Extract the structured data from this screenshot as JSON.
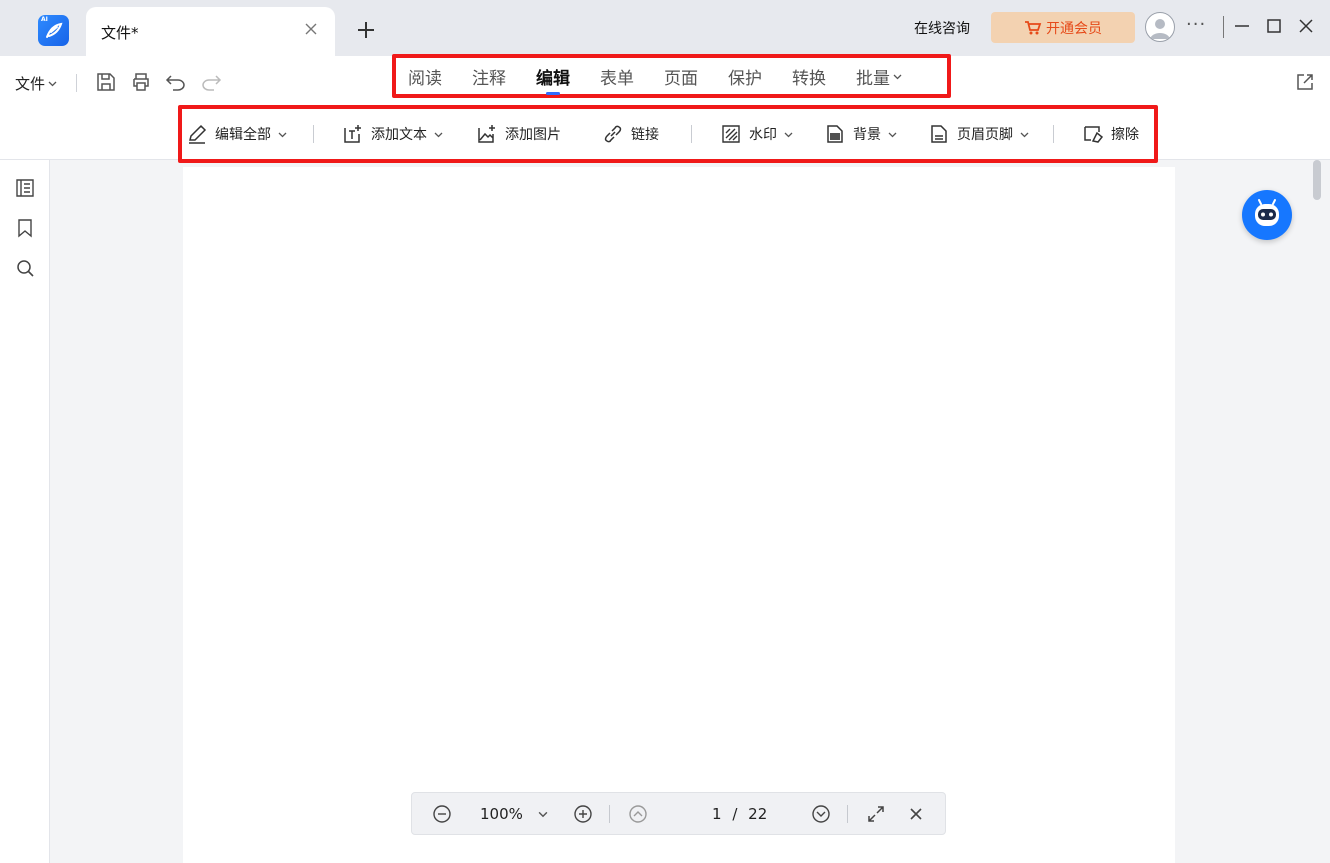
{
  "titlebar": {
    "logo_text": "AI",
    "tab_title": "文件*",
    "consult_label": "在线咨询",
    "vip_label": "开通会员",
    "more_label": "···"
  },
  "toolbar": {
    "file_menu_label": "文件",
    "menu_tabs": [
      {
        "label": "阅读"
      },
      {
        "label": "注释"
      },
      {
        "label": "编辑"
      },
      {
        "label": "表单"
      },
      {
        "label": "页面"
      },
      {
        "label": "保护"
      },
      {
        "label": "转换"
      },
      {
        "label": "批量"
      }
    ],
    "active_tab": "编辑",
    "tools": {
      "edit_all": "编辑全部",
      "add_text": "添加文本",
      "add_image": "添加图片",
      "link": "链接",
      "watermark": "水印",
      "background": "背景",
      "header_footer": "页眉页脚",
      "erase": "擦除"
    }
  },
  "bottombar": {
    "zoom": "100%",
    "page_current": "1",
    "page_separator": "/",
    "page_total": "22"
  },
  "colors": {
    "accent": "#2f6bff",
    "highlight_box": "#f01919",
    "vip_bg": "#f3d2b1",
    "vip_text": "#e64a19",
    "ai_bot": "#1677ff"
  }
}
